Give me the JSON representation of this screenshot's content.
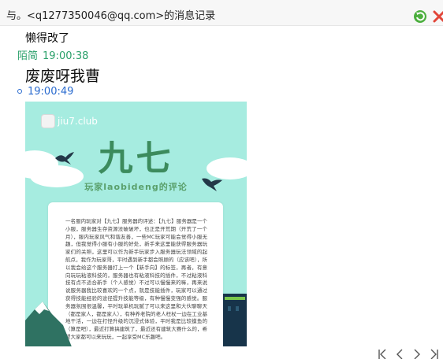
{
  "window": {
    "title": "与。<q1277350046@qq.com>的消息记录"
  },
  "messages": [
    {
      "text": "懒得改了"
    },
    {
      "sender": "陌简",
      "time": "19:00:38",
      "text": "废废呀我曹",
      "sender_color": "#2aa06a"
    },
    {
      "time": "19:00:49",
      "time_color": "#2a6bcf",
      "image": {
        "site": "jiu7.club",
        "brand": "九七",
        "subtitle": "玩家laobideng的评论",
        "body": "一名服内玩家对【九七】服务器的评述：【九七】服务器是一个小服，服务器生存资源没破破坏，也正是开荒期（开荒了一个月），服内玩家风气和谐友善，一些MC玩家可能会觉得小服无趣，但我觉得小服有小服的好处，新手来这里能获得服务器玩家们的关照，这里可以作为新手玩家步入服务器玩法领域的起航点，我作为玩家哥，平时遇到新手都会照顾的（应该吧），所以我会给这个服务器打上一个【新手向】的标签，再者，有意向玩玩粘液科技的，服务器也有粘液科技的插件，不过粘液科技有点不适合新手（个人感觉）不过可以慢慢来的嘛，再来说说服务器我比较喜欢的一个点，就是技能插件，玩家可以通过获得技能经验的途径提升技能等级，有种慢慢变强的感觉。服务器氛围很温馨，平时玩单机玩腻了可以来这里和大伙聊聊天（都是家人，都是家人），有种养老院的老人枉杖一边在工业基地干活，一边在打怪升级的沉浸式体验，平时我是比较摸鱼的（算是吧），最近打算搞建筑了，最近还有建筑大赛什么的，希望大家都可以来玩玩，一起享受MC乐趣吧。"
      }
    }
  ],
  "colors": {
    "accent_green": "#2aa06a",
    "accent_blue": "#2a6bcf",
    "image_bg": "#a6ece0",
    "brand_green": "#3c8b5d"
  },
  "icons": {
    "refresh": "refresh-icon",
    "close": "close-icon",
    "first": "first-page-icon",
    "prev": "prev-page-icon",
    "next": "next-page-icon",
    "last": "last-page-icon"
  }
}
